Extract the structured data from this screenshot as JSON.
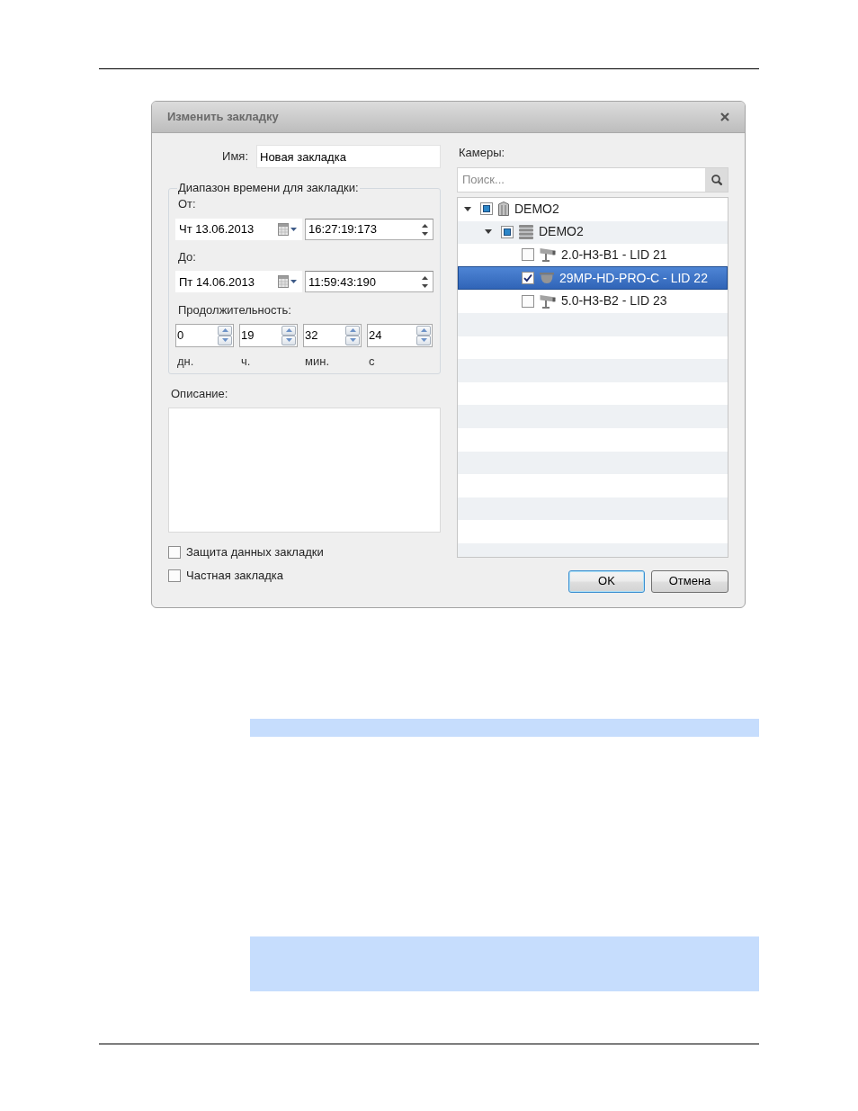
{
  "dialog": {
    "title": "Изменить закладку"
  },
  "name_field": {
    "label": "Имя:",
    "value": "Новая закладка"
  },
  "time_range": {
    "legend": "Диапазон времени для закладки:",
    "from": {
      "label": "От:",
      "date": "Чт 13.06.2013",
      "time": "16:27:19:173"
    },
    "to": {
      "label": "До:",
      "date": "Пт 14.06.2013",
      "time": "11:59:43:190"
    },
    "duration": {
      "label": "Продолжительность:",
      "fields": [
        {
          "value": "0",
          "unit": "дн."
        },
        {
          "value": "19",
          "unit": "ч."
        },
        {
          "value": "32",
          "unit": "мин."
        },
        {
          "value": "24",
          "unit": "с"
        }
      ]
    }
  },
  "description": {
    "label": "Описание:"
  },
  "options": [
    {
      "label": "Защита данных закладки",
      "checked": false
    },
    {
      "label": "Частная закладка",
      "checked": false
    }
  ],
  "cameras": {
    "label": "Камеры:",
    "search": {
      "placeholder": "Поиск..."
    },
    "tree": [
      {
        "kind": "site",
        "label": "DEMO2",
        "checked": false,
        "indeterminate": true,
        "expanded": true,
        "selected": false,
        "children": [
          {
            "kind": "server",
            "label": "DEMO2",
            "checked": false,
            "indeterminate": true,
            "expanded": true,
            "selected": false,
            "children": [
              {
                "kind": "camera",
                "label": "2.0-H3-B1 - LID 21",
                "checked": false,
                "indeterminate": false,
                "selected": false
              },
              {
                "kind": "dome-camera",
                "label": "29MP-HD-PRO-C - LID 22",
                "checked": true,
                "indeterminate": false,
                "selected": true
              },
              {
                "kind": "camera",
                "label": "5.0-H3-B2 - LID 23",
                "checked": false,
                "indeterminate": false,
                "selected": false
              }
            ]
          }
        ]
      }
    ]
  },
  "buttons": [
    {
      "label": "OK",
      "focused": true
    },
    {
      "label": "Отмена",
      "focused": false
    }
  ]
}
